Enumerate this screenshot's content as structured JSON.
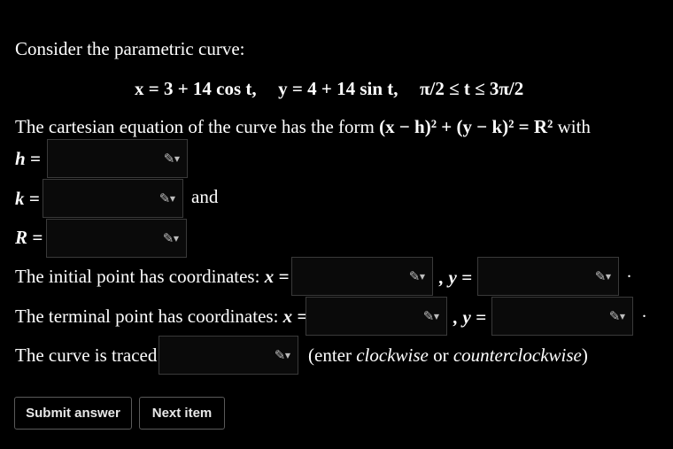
{
  "intro": "Consider the parametric curve:",
  "equation": {
    "x": "x = 3 + 14 cos t,",
    "y": "y = 4 + 14 sin t,",
    "range": "π/2 ≤ t ≤ 3π/2"
  },
  "cartesian": {
    "prefix": "The cartesian equation of the curve has the form",
    "form": "(x − h)² + (y − k)² = R²",
    "suffix": "with"
  },
  "labels": {
    "h": "h =",
    "k": "k =",
    "and": "and",
    "R": "R =",
    "initial": "The initial point has coordinates:",
    "terminal": "The terminal point has coordinates:",
    "x_eq": "x =",
    "y_eq": ", y =",
    "period": ".",
    "traced": "The curve is traced",
    "enter_open": "(enter",
    "clockwise": "clockwise",
    "or": "or",
    "counterclockwise": "counterclockwise",
    "enter_close": ")"
  },
  "inputs": {
    "h": "",
    "k": "",
    "R": "",
    "initial_x": "",
    "initial_y": "",
    "terminal_x": "",
    "terminal_y": "",
    "direction": ""
  },
  "icons": {
    "edit": "pencil-icon"
  },
  "buttons": {
    "submit": "Submit answer",
    "next": "Next item"
  }
}
